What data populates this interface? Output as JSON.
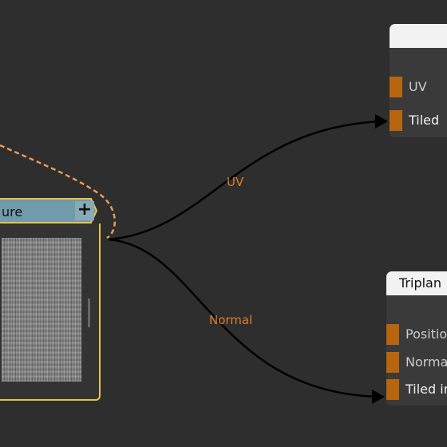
{
  "source_node": {
    "title": "ure",
    "add_label": "+"
  },
  "connections": {
    "uv_label": "UV",
    "normal_label": "Normal"
  },
  "target_node_1": {
    "title": "",
    "ports": [
      "UV",
      "Tiled"
    ]
  },
  "target_node_2": {
    "title": "Triplan",
    "ports": [
      "Positio",
      "Norma",
      "Tiled in"
    ]
  },
  "colors": {
    "background": "#2e2e2e",
    "wire": "#000000",
    "wire_label": "#e07b2a",
    "port": "#b8650f",
    "selection_border": "#e8c24a",
    "texture_header": "#6f9bab"
  }
}
